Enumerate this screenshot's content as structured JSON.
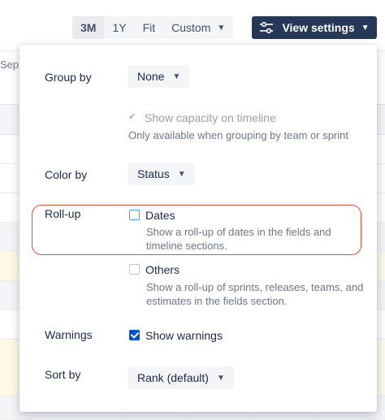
{
  "timeline": {
    "month_fragment": "Sep"
  },
  "range": {
    "options": [
      "3M",
      "1Y",
      "Fit",
      "Custom"
    ],
    "active": "3M"
  },
  "view_settings": {
    "label": "View settings"
  },
  "popup": {
    "group_by": {
      "label": "Group by",
      "value": "None"
    },
    "capacity": {
      "label": "Show capacity on timeline",
      "checked": true,
      "disabled": true,
      "help": "Only available when grouping by team or sprint"
    },
    "color_by": {
      "label": "Color by",
      "value": "Status"
    },
    "rollup": {
      "label": "Roll-up",
      "dates": {
        "label": "Dates",
        "checked": false,
        "help_line1": "Show a roll-up of dates in the fields and",
        "help_line2": "timeline sections."
      },
      "others": {
        "label": "Others",
        "checked": false,
        "help_line1": "Show a roll-up of sprints, releases, teams, and",
        "help_line2": "estimates in the fields section."
      }
    },
    "warnings": {
      "label": "Warnings",
      "option_label": "Show warnings",
      "checked": true
    },
    "sort_by": {
      "label": "Sort by",
      "value": "Rank (default)"
    }
  },
  "colors": {
    "view_settings_bg": "#253858",
    "checkbox_checked": "#0052cc",
    "highlight_outline": "#de4f34",
    "row_highlight": "#fffae6"
  },
  "icons": {
    "view_settings": "sliders-icon",
    "dropdown": "chevron-down-icon",
    "capacity_check": "check-icon"
  }
}
